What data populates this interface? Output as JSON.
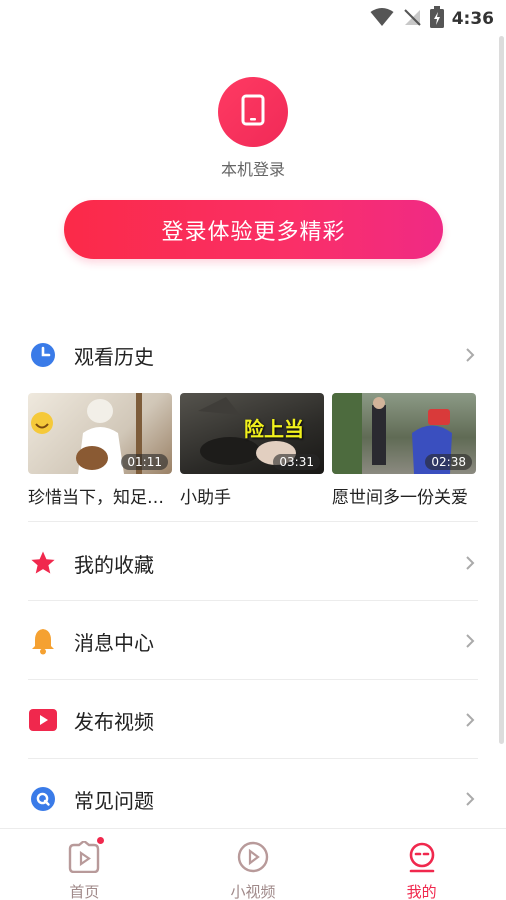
{
  "status_bar": {
    "time": "4:36"
  },
  "login": {
    "label": "本机登录",
    "button_label": "登录体验更多精彩"
  },
  "menu": {
    "history": {
      "label": "观看历史"
    },
    "favorites": {
      "label": "我的收藏"
    },
    "messages": {
      "label": "消息中心"
    },
    "publish": {
      "label": "发布视频"
    },
    "faq": {
      "label": "常见问题"
    }
  },
  "history_items": [
    {
      "title": "珍惜当下，知足常乐",
      "duration": "01:11",
      "thumb_color": "#d9d3c8",
      "overlay": ""
    },
    {
      "title": "小助手",
      "duration": "03:31",
      "thumb_color": "#3c3a36",
      "overlay": "险上当"
    },
    {
      "title": "愿世间多一份关爱",
      "duration": "02:38",
      "thumb_color": "#6f7a62",
      "overlay": ""
    }
  ],
  "bottom_nav": [
    {
      "label": "首页",
      "active": false,
      "badge": true
    },
    {
      "label": "小视频",
      "active": false,
      "badge": false
    },
    {
      "label": "我的",
      "active": true,
      "badge": false
    }
  ],
  "colors": {
    "accent": "#f0284d",
    "text": "#222222",
    "muted": "#a08a8a"
  }
}
